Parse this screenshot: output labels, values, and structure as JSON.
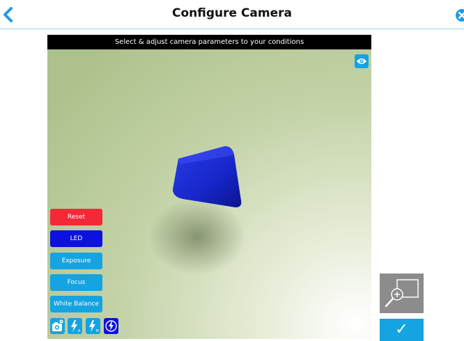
{
  "header": {
    "title": "Configure Camera",
    "back_icon": "chevron-left-icon",
    "close_icon": "close-circle-icon"
  },
  "preview": {
    "banner": "Select & adjust camera parameters to your conditions",
    "eye_icon": "eye-icon"
  },
  "controls": {
    "reset_label": "Reset",
    "led_label": "LED",
    "exposure_label": "Exposure",
    "focus_label": "Focus",
    "white_balance_label": "White Balance"
  },
  "mini_controls": [
    {
      "icon": "camera-settings-icon"
    },
    {
      "icon": "flash-auto-icon",
      "letter": "A"
    },
    {
      "icon": "flash-manual-icon",
      "letter": "M"
    },
    {
      "icon": "flash-off-icon"
    }
  ],
  "actions": {
    "zoom_icon": "zoom-in-icon",
    "confirm_label": "✓"
  },
  "colors": {
    "accent": "#15a3e1",
    "reset": "#f22a38",
    "led": "#0c10e0",
    "zoom_bg": "#8c8c8c"
  }
}
